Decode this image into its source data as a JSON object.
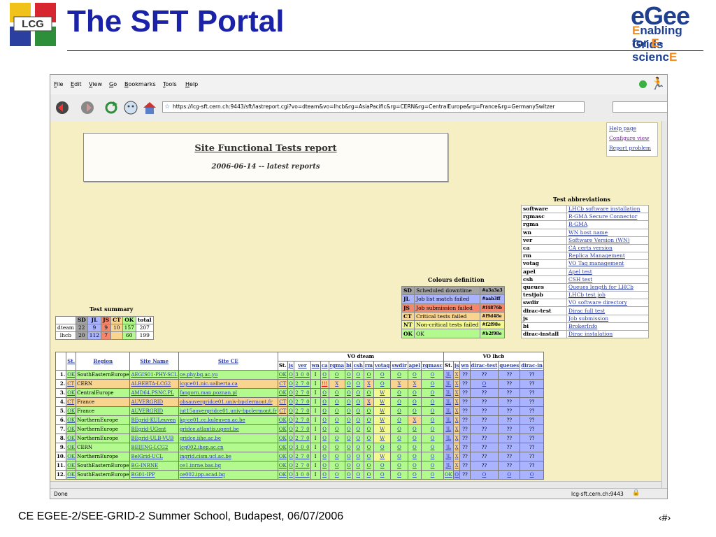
{
  "slide": {
    "title": "The SFT Portal",
    "lcg_logo_text": "LCG",
    "egee_logo": {
      "word": "eGee",
      "line1_a": "E",
      "line1_b": "nabling Grids",
      "line2_a": "for ",
      "line2_b": "E",
      "line2_c": "-scienc",
      "line2_d": "E"
    },
    "footer": "CE EGEE-2/SEE-GRID-2 Summer School, Budapest, 06/07/2006",
    "page_number": "‹#›"
  },
  "browser": {
    "menu": [
      "File",
      "Edit",
      "View",
      "Go",
      "Bookmarks",
      "Tools",
      "Help"
    ],
    "menu_underline": [
      "F",
      "E",
      "V",
      "G",
      "B",
      "T",
      "H"
    ],
    "url": "https://lcg-sft.cern.ch:9443/sft/lastreport.cgi?vo=dteam&vo=lhcb&rg=AsiaPacific&rg=CERN&rg=CentralEurope&rg=France&rg=GermanySwitzer",
    "status_left": "Done",
    "status_host": "lcg-sft.cern.ch:9443"
  },
  "report": {
    "title": "Site Functional Tests report",
    "subtitle": "2006-06-14 -- latest reports",
    "help_links": [
      "Help page",
      "Configure view",
      "Report problem"
    ]
  },
  "abbreviations": {
    "title": "Test abbreviations",
    "rows": [
      {
        "k": "software",
        "v": "LHCb software installation"
      },
      {
        "k": "rgmasc",
        "v": "R-GMA Secure Connector"
      },
      {
        "k": "rgma",
        "v": "R-GMA"
      },
      {
        "k": "wn",
        "v": "WN host name"
      },
      {
        "k": "ver",
        "v": "Software Version (WN)"
      },
      {
        "k": "ca",
        "v": "CA certs version"
      },
      {
        "k": "rm",
        "v": "Replica Management"
      },
      {
        "k": "votag",
        "v": "VO Tag management"
      },
      {
        "k": "apel",
        "v": "Apel test"
      },
      {
        "k": "csh",
        "v": "CSH test"
      },
      {
        "k": "queues",
        "v": "Queues length for LHCb"
      },
      {
        "k": "testjob",
        "v": "LHCb test job"
      },
      {
        "k": "swdir",
        "v": "VO software directory"
      },
      {
        "k": "dirac-test",
        "v": "Dirac full test"
      },
      {
        "k": "js",
        "v": "Job submission"
      },
      {
        "k": "bi",
        "v": "BrokerInfo"
      },
      {
        "k": "dirac-install",
        "v": "Dirac instalation"
      }
    ]
  },
  "colours": {
    "title": "Colours definition",
    "rows": [
      {
        "k": "SD",
        "label": "Scheduled downtime",
        "code": "#a3a3a3",
        "color": "#a3a3a3"
      },
      {
        "k": "JL",
        "label": "Job list match failed",
        "code": "#aab3ff",
        "color": "#aab3ff"
      },
      {
        "k": "JS",
        "label": "Job submission failed",
        "code": "#f4876b",
        "color": "#f4876b"
      },
      {
        "k": "CT",
        "label": "Critical tests failed",
        "code": "#f9d48e",
        "color": "#f9d48e"
      },
      {
        "k": "NT",
        "label": "Non-critical tests failed",
        "code": "#f2f98e",
        "color": "#f2f98e"
      },
      {
        "k": "OK",
        "label": "OK",
        "code": "#b2f98e",
        "color": "#b2f98e"
      }
    ]
  },
  "summary": {
    "title": "Test summary",
    "headers": [
      "",
      "SD",
      "JL",
      "JS",
      "CT",
      "OK",
      "total"
    ],
    "rows": [
      {
        "vo": "dteam",
        "cells": [
          "22",
          "9",
          "9",
          "10",
          "157",
          "207"
        ]
      },
      {
        "vo": "lhcb",
        "cells": [
          "20",
          "112",
          "7",
          "",
          "60",
          "199"
        ]
      }
    ]
  },
  "sites": {
    "group_headers": {
      "dteam": "VO dteam",
      "lhcb": "VO lhcb"
    },
    "main_headers": [
      "",
      "St.",
      "Region",
      "Site Name",
      "Site CE"
    ],
    "dteam_headers": [
      "St.",
      "js",
      "ver",
      "wn",
      "ca",
      "rgma",
      "bi",
      "csh",
      "rm",
      "votag",
      "swdir",
      "apel",
      "rgmasc"
    ],
    "lhcb_headers": [
      "St.",
      "js",
      "wn",
      "dirac-test",
      "queues",
      "dirac-in"
    ],
    "rows": [
      {
        "n": "1.",
        "st": "OK",
        "region": "SouthEasternEurope",
        "site": "AEGIS01-PHY-SCL",
        "ce": "ce.phy.bg.ac.yu",
        "d": [
          "OK",
          "O",
          "3_0_0",
          "I",
          "O",
          "O",
          "O",
          "O",
          "O",
          "O",
          "O",
          "O",
          "O"
        ],
        "l": [
          "JL",
          "X",
          "??",
          "??",
          "??",
          "??"
        ]
      },
      {
        "n": "2.",
        "st": "CT",
        "region": "CERN",
        "site": "ALBERTA-LCG2",
        "ce": "lcgce01.nic.ualberta.ca",
        "d": [
          "CT",
          "O",
          "2_7_0",
          "I",
          "!!!",
          "X",
          "O",
          "O",
          "X",
          "O",
          "X",
          "X",
          "O"
        ],
        "l": [
          "JL",
          "X",
          "??",
          "O",
          "??",
          "??"
        ]
      },
      {
        "n": "3.",
        "st": "OK",
        "region": "CentralEurope",
        "site": "AMD64.PSNC.PL",
        "ce": "fangorn.man.poznan.pl",
        "d": [
          "OK",
          "O",
          "2_7_0",
          "I",
          "O",
          "O",
          "O",
          "O",
          "O",
          "W",
          "O",
          "O",
          "O"
        ],
        "l": [
          "JL",
          "X",
          "??",
          "??",
          "??",
          "??"
        ]
      },
      {
        "n": "4.",
        "st": "CT",
        "region": "France",
        "site": "AUVERGRID",
        "ce": "obsauvergridce01.univ-bpclermont.fr",
        "d": [
          "CT",
          "O",
          "2_7_0",
          "I",
          "O",
          "O",
          "O",
          "O",
          "X",
          "W",
          "O",
          "O",
          "O"
        ],
        "l": [
          "JL",
          "X",
          "??",
          "??",
          "??",
          "??"
        ]
      },
      {
        "n": "5.",
        "st": "OK",
        "region": "France",
        "site": "AUVERGRID",
        "ce": "iut15auvergridce01.univ-bpclermont.fr",
        "d": [
          "CT",
          "O",
          "2_7_0",
          "I",
          "O",
          "O",
          "O",
          "O",
          "O",
          "W",
          "O",
          "O",
          "O"
        ],
        "l": [
          "JL",
          "X",
          "??",
          "??",
          "??",
          "??"
        ]
      },
      {
        "n": "6.",
        "st": "OK",
        "region": "NorthernEurope",
        "site": "BEgrid-KULeuven",
        "ce": "kg-ce01.cc.kuleuven.ac.be",
        "d": [
          "OK",
          "O",
          "2_7_0",
          "I",
          "O",
          "O",
          "O",
          "O",
          "O",
          "W",
          "O",
          "X",
          "O"
        ],
        "l": [
          "JL",
          "X",
          "??",
          "??",
          "??",
          "??"
        ]
      },
      {
        "n": "7.",
        "st": "OK",
        "region": "NorthernEurope",
        "site": "BEgrid-UGent",
        "ce": "gridce.atlantis.ugent.be",
        "d": [
          "OK",
          "O",
          "2_7_0",
          "I",
          "O",
          "O",
          "O",
          "O",
          "O",
          "W",
          "O",
          "O",
          "O"
        ],
        "l": [
          "JL",
          "X",
          "??",
          "??",
          "??",
          "??"
        ]
      },
      {
        "n": "8.",
        "st": "OK",
        "region": "NorthernEurope",
        "site": "BEgrid-ULB-VUB",
        "ce": "gridce.iihe.ac.be",
        "d": [
          "OK",
          "O",
          "2_7_0",
          "I",
          "O",
          "O",
          "O",
          "O",
          "O",
          "W",
          "O",
          "O",
          "O"
        ],
        "l": [
          "JL",
          "X",
          "??",
          "??",
          "??",
          "??"
        ]
      },
      {
        "n": "9.",
        "st": "OK",
        "region": "CERN",
        "site": "BEIJING-LCG2",
        "ce": "lcg002.ihep.ac.cn",
        "d": [
          "OK",
          "O",
          "3_0_0",
          "I",
          "O",
          "O",
          "O",
          "O",
          "O",
          "O",
          "O",
          "O",
          "O"
        ],
        "l": [
          "JL",
          "X",
          "??",
          "??",
          "??",
          "??"
        ]
      },
      {
        "n": "10.",
        "st": "OK",
        "region": "NorthernEurope",
        "site": "BelGrid-UCL",
        "ce": "ingrid.cism.ucl.ac.be",
        "d": [
          "OK",
          "O",
          "2_7_0",
          "I",
          "O",
          "O",
          "O",
          "O",
          "O",
          "W",
          "O",
          "O",
          "O"
        ],
        "l": [
          "JL",
          "X",
          "??",
          "??",
          "??",
          "??"
        ]
      },
      {
        "n": "11.",
        "st": "OK",
        "region": "SouthEasternEurope",
        "site": "BG-INRNE",
        "ce": "ce1.inrne.bas.bg",
        "d": [
          "OK",
          "O",
          "2_7_0",
          "I",
          "O",
          "O",
          "O",
          "O",
          "O",
          "O",
          "O",
          "O",
          "O"
        ],
        "l": [
          "JL",
          "X",
          "??",
          "??",
          "??",
          "??"
        ]
      },
      {
        "n": "12.",
        "st": "OK",
        "region": "SouthEasternEurope",
        "site": "BG01-IPP",
        "ce": "ce002.ipp.acad.bg",
        "d": [
          "OK",
          "O",
          "3_0_0",
          "I",
          "O",
          "O",
          "O",
          "O",
          "O",
          "O",
          "O",
          "O",
          "O"
        ],
        "l": [
          "OK",
          "O",
          "??",
          "O",
          "O",
          "O"
        ]
      }
    ]
  },
  "colors": {
    "title_blue": "#1a23a8",
    "egee_blue": "#1f3f8f",
    "egee_orange": "#f28c1e",
    "page_bg": "#f6efc4",
    "link": "#2b3ca8"
  }
}
